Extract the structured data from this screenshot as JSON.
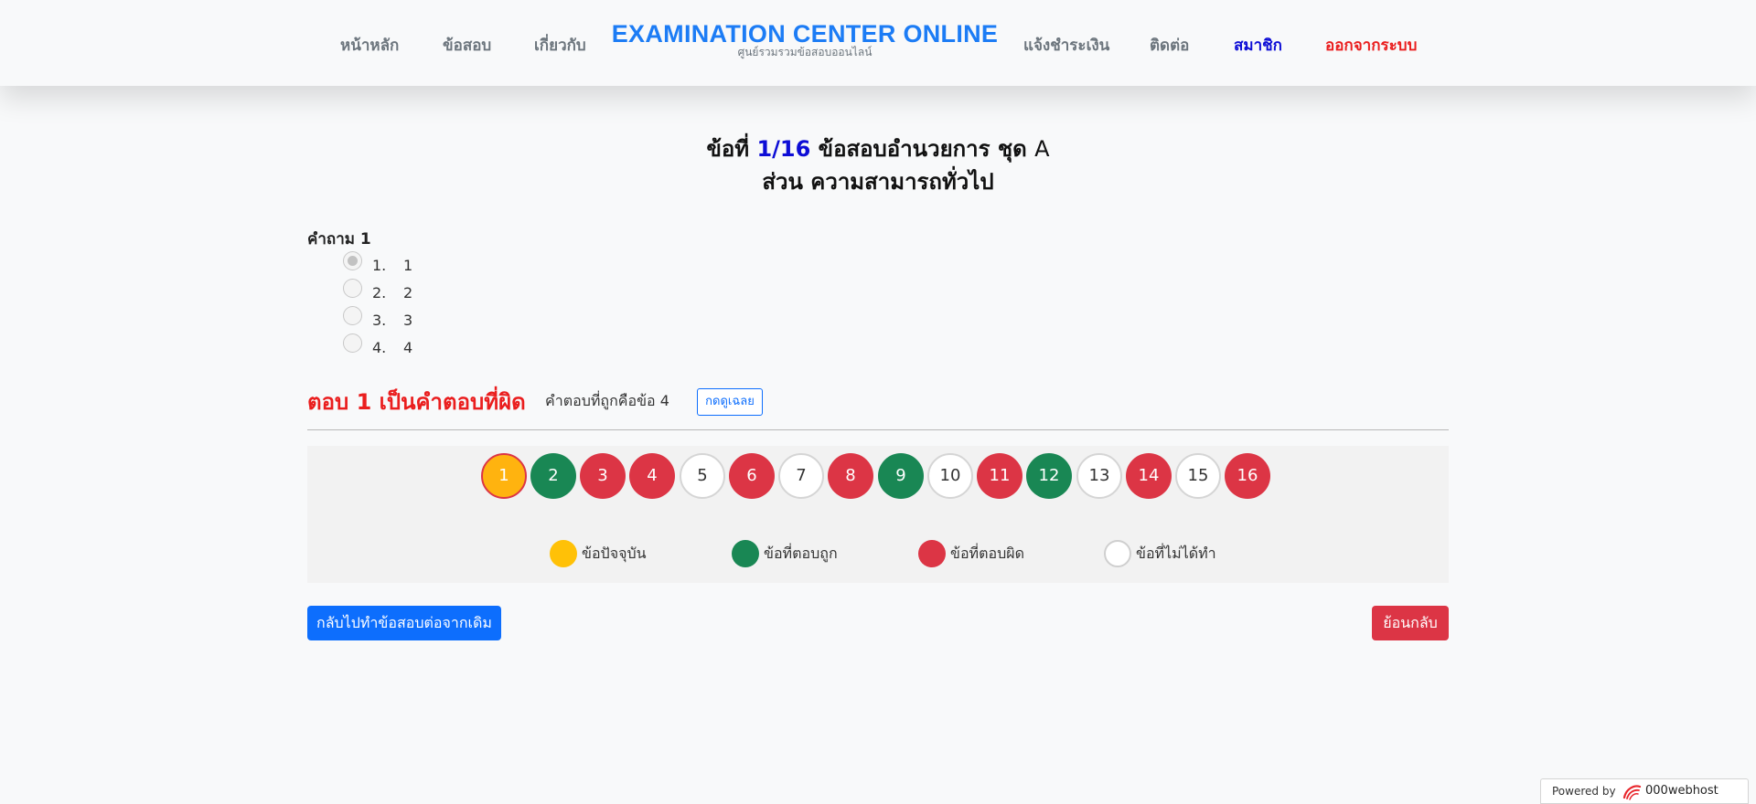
{
  "nav": {
    "left_items": [
      "หน้าหลัก",
      "ข้อสอบ",
      "เกี่ยวกับ"
    ],
    "brand_title": "EXAMINATION CENTER ONLINE",
    "brand_subtitle": "ศูนย์รวมรวมข้อสอบออนไลน์",
    "right_items": [
      "แจ้งชำระเงิน",
      "ติดต่อ"
    ],
    "member": "สมาชิก",
    "logout": "ออกจากระบบ",
    "member_color": "#0d0dd6",
    "logout_color": "#ea1e1e",
    "brand_color": "#1c7cf5"
  },
  "heading": {
    "prefix": "ข้อที่",
    "number": "1/16",
    "exam_title": "ข้อสอบอำนวยการ ชุด",
    "set": "A",
    "section": "ส่วน ความสามารถทั่วไป"
  },
  "question": {
    "label": "คำถาม 1",
    "choices": [
      {
        "num": "1.",
        "text": "1",
        "selected": true
      },
      {
        "num": "2.",
        "text": "2",
        "selected": false
      },
      {
        "num": "3.",
        "text": "3",
        "selected": false
      },
      {
        "num": "4.",
        "text": "4",
        "selected": false
      }
    ]
  },
  "result": {
    "wrong_text": "ตอบ 1 เป็นคำตอบที่ผิด",
    "correct_text": "คำตอบที่ถูกคือข้อ 4",
    "reveal_button": "กดดูเฉลย"
  },
  "question_nav": [
    {
      "n": "1",
      "status": "current"
    },
    {
      "n": "2",
      "status": "correct"
    },
    {
      "n": "3",
      "status": "wrong"
    },
    {
      "n": "4",
      "status": "wrong"
    },
    {
      "n": "5",
      "status": "unanswered"
    },
    {
      "n": "6",
      "status": "wrong"
    },
    {
      "n": "7",
      "status": "unanswered"
    },
    {
      "n": "8",
      "status": "wrong"
    },
    {
      "n": "9",
      "status": "correct"
    },
    {
      "n": "10",
      "status": "unanswered"
    },
    {
      "n": "11",
      "status": "wrong"
    },
    {
      "n": "12",
      "status": "correct"
    },
    {
      "n": "13",
      "status": "unanswered"
    },
    {
      "n": "14",
      "status": "wrong"
    },
    {
      "n": "15",
      "status": "unanswered"
    },
    {
      "n": "16",
      "status": "wrong"
    }
  ],
  "legend": [
    {
      "key": "current",
      "label": "ข้อปัจจุบัน",
      "color": "#ffc107"
    },
    {
      "key": "correct",
      "label": "ข้อที่ตอบถูก",
      "color": "#198754"
    },
    {
      "key": "wrong",
      "label": "ข้อที่ตอบผิด",
      "color": "#dc3545"
    },
    {
      "key": "unanswered",
      "label": "ข้อที่ไม่ได้ทำ",
      "color": "#ffffff"
    }
  ],
  "buttons": {
    "continue": "กลับไปทำข้อสอบต่อจากเดิม",
    "back": "ย้อนกลับ"
  },
  "footer": {
    "powered_by": "Powered by",
    "host_brand": "000webhost"
  }
}
